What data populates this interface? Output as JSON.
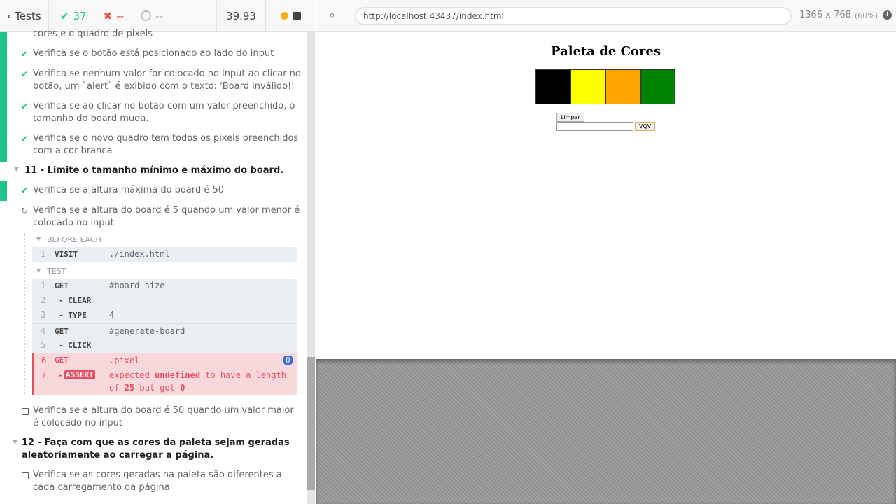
{
  "header": {
    "tests_label": "Tests",
    "passed": "37",
    "failed": "--",
    "pending": "--",
    "duration": "39.93",
    "url": "http://localhost:43437/index.html",
    "viewport": "1366 x 768",
    "scale": "(60%)"
  },
  "tests": {
    "prev_tail": "cores e o quadro de pixels",
    "t1": "Verifica se o botão está posicionado ao lado do input",
    "t2a": "Verifica se nenhum valor for colocado no input ao clicar no",
    "t2b": "botão, um `alert` é exibido com o texto: 'Board inválido!'",
    "t3a": "Verifica se ao clicar no botão com um valor preenchido, o",
    "t3b": "tamanho do board muda.",
    "t4a": "Verifica se o novo quadro tem todos os pixels preenchidos",
    "t4b": "com a cor branca",
    "suite11": "11 - Limite o tamanho mínimo e máximo do board.",
    "s11t1": "Verifica se a altura máxima do board é 50",
    "s11t2a": "Verifica se a altura do board é 5 quando um valor menor é",
    "s11t2b": "colocado no input",
    "s11t3a": "Verifica se a altura do board é 50 quando um valor maior",
    "s11t3b": "é colocado no input",
    "suite12a": "12 - Faça com que as cores da paleta sejam geradas",
    "suite12b": "aleatoriamente ao carregar a página.",
    "s12t1a": "Verifica se as cores geradas na paleta são diferentes a",
    "s12t1b": "cada carregamento da página"
  },
  "log": {
    "before_each": "BEFORE EACH",
    "test": "TEST",
    "be": [
      {
        "n": "1",
        "name": "VISIT",
        "arg": "./index.html"
      }
    ],
    "cmds": [
      {
        "n": "1",
        "name": "GET",
        "arg": "#board-size"
      },
      {
        "n": "2",
        "name": "- CLEAR",
        "arg": ""
      },
      {
        "n": "3",
        "name": "- TYPE",
        "arg": "4"
      },
      {
        "n": "4",
        "name": "GET",
        "arg": "#generate-board"
      },
      {
        "n": "5",
        "name": "- CLICK",
        "arg": ""
      }
    ],
    "err_get": {
      "n": "6",
      "name": "GET",
      "arg": ".pixel",
      "badge": "0"
    },
    "err_assert": {
      "n": "7",
      "dash": "-",
      "name": "ASSERT",
      "w1": "expected",
      "w2": "undefined",
      "w3": "to have a length",
      "w4": "of",
      "w5": "25",
      "w6": "but got",
      "w7": "0"
    }
  },
  "app": {
    "title": "Paleta de Cores",
    "colors": [
      "#000000",
      "#ffff00",
      "#ffa500",
      "#008000"
    ],
    "clear_button": "Limpar",
    "generate_button": "VQV",
    "input_value": ""
  }
}
